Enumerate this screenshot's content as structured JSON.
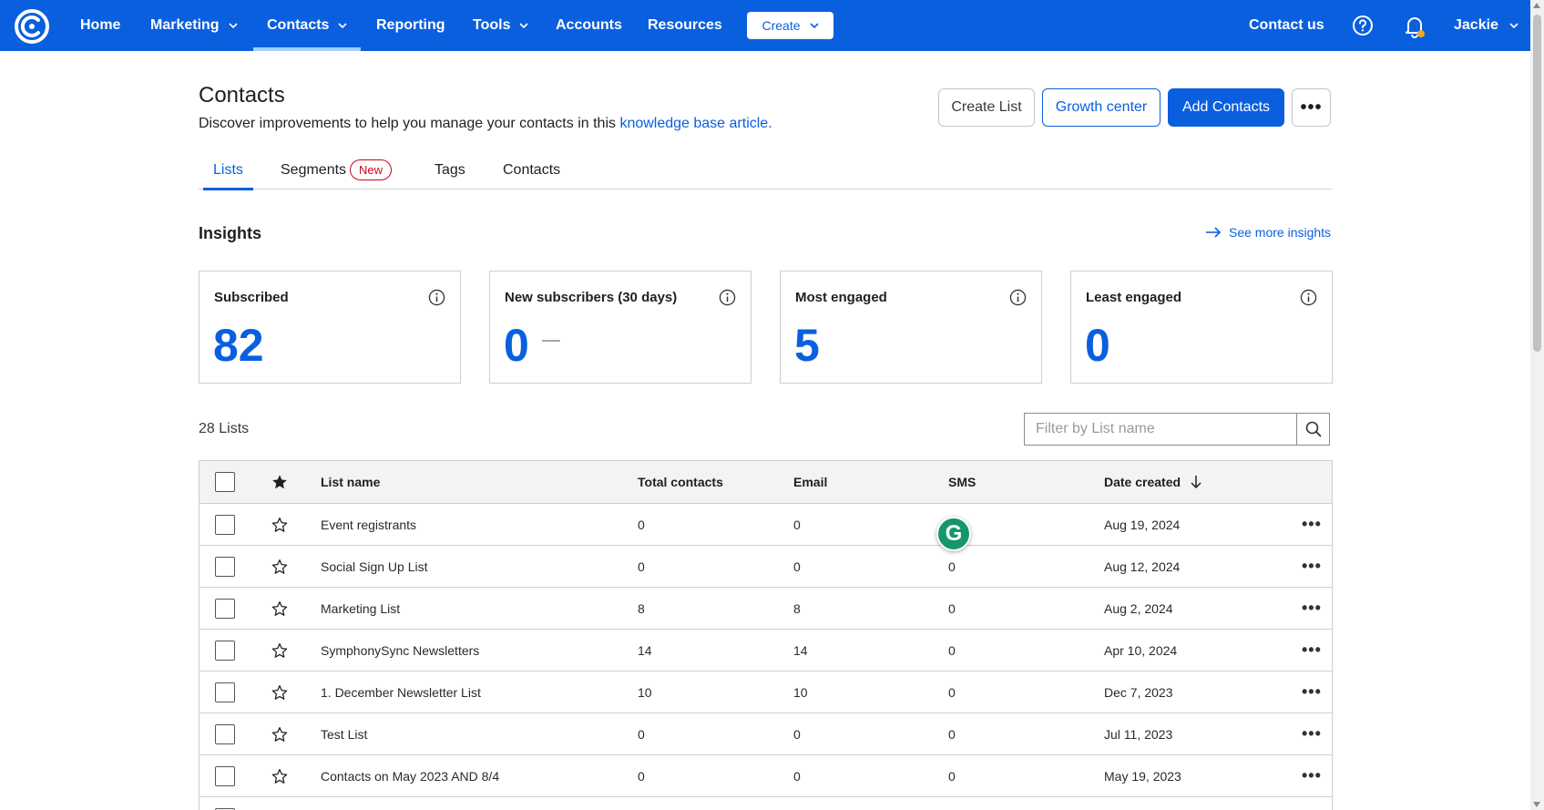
{
  "nav": {
    "items": [
      {
        "label": "Home",
        "has_dropdown": false,
        "active": false
      },
      {
        "label": "Marketing",
        "has_dropdown": true,
        "active": false
      },
      {
        "label": "Contacts",
        "has_dropdown": true,
        "active": true
      },
      {
        "label": "Reporting",
        "has_dropdown": false,
        "active": false
      },
      {
        "label": "Tools",
        "has_dropdown": true,
        "active": false
      },
      {
        "label": "Accounts",
        "has_dropdown": false,
        "active": false
      },
      {
        "label": "Resources",
        "has_dropdown": false,
        "active": false
      }
    ],
    "create_label": "Create",
    "contact_us": "Contact us",
    "user_name": "Jackie",
    "notification_dot_color": "#f5a623"
  },
  "colors": {
    "brand": "#0a5fdf",
    "new_badge": "#d0021b",
    "grammarly": "#15966c"
  },
  "header": {
    "title": "Contacts",
    "description_prefix": "Discover improvements to help you manage your contacts in this ",
    "description_link": "knowledge base article.",
    "buttons": {
      "create_list": "Create List",
      "growth_center": "Growth center",
      "add_contacts": "Add Contacts",
      "more": "•••"
    }
  },
  "tabs": [
    {
      "label": "Lists",
      "active": true
    },
    {
      "label": "Segments",
      "badge": "New",
      "active": false
    },
    {
      "label": "Tags",
      "active": false
    },
    {
      "label": "Contacts",
      "active": false
    }
  ],
  "insights": {
    "title": "Insights",
    "see_more": "See more insights",
    "cards": [
      {
        "label": "Subscribed",
        "value": "82"
      },
      {
        "label": "New subscribers (30 days)",
        "value": "0"
      },
      {
        "label": "Most engaged",
        "value": "5"
      },
      {
        "label": "Least engaged",
        "value": "0"
      }
    ]
  },
  "lists": {
    "count_label": "28 Lists",
    "filter_placeholder": "Filter by List name",
    "columns": {
      "name": "List name",
      "total": "Total contacts",
      "email": "Email",
      "sms": "SMS",
      "date": "Date created"
    },
    "rows": [
      {
        "name": "Event registrants",
        "total": "0",
        "email": "0",
        "sms": "",
        "date": "Aug 19, 2024"
      },
      {
        "name": "Social Sign Up List",
        "total": "0",
        "email": "0",
        "sms": "0",
        "date": "Aug 12, 2024"
      },
      {
        "name": "Marketing List",
        "total": "8",
        "email": "8",
        "sms": "0",
        "date": "Aug 2, 2024"
      },
      {
        "name": "SymphonySync Newsletters",
        "total": "14",
        "email": "14",
        "sms": "0",
        "date": "Apr 10, 2024"
      },
      {
        "name": "1. December Newsletter List",
        "total": "10",
        "email": "10",
        "sms": "0",
        "date": "Dec 7, 2023"
      },
      {
        "name": "Test List",
        "total": "0",
        "email": "0",
        "sms": "0",
        "date": "Jul 11, 2023"
      },
      {
        "name": "Contacts on May 2023 AND 8/4",
        "total": "0",
        "email": "0",
        "sms": "0",
        "date": "May 19, 2023"
      }
    ],
    "row_more": "•••"
  },
  "grammarly_glyph": "G"
}
